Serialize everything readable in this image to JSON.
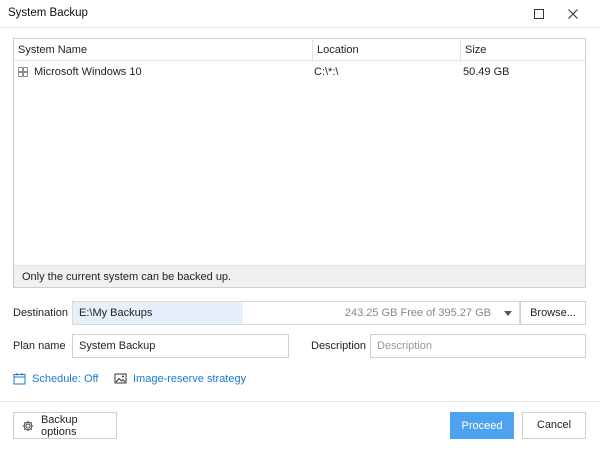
{
  "window": {
    "title": "System Backup"
  },
  "table": {
    "columns": [
      "System Name",
      "Location",
      "Size"
    ],
    "rows": [
      {
        "name": "Microsoft Windows 10",
        "location": "C:\\*:\\",
        "size": "50.49 GB"
      }
    ],
    "footer_note": "Only the current system can be backed up."
  },
  "destination": {
    "label": "Destination",
    "path": "E:\\My Backups",
    "free_space": "243.25 GB Free of 395.27 GB",
    "browse_label": "Browse..."
  },
  "plan": {
    "label": "Plan name",
    "value": "System Backup"
  },
  "description": {
    "label": "Description",
    "placeholder": "Description"
  },
  "links": {
    "schedule": "Schedule: Off",
    "strategy": "Image-reserve strategy"
  },
  "footer": {
    "options_label": "Backup options",
    "proceed_label": "Proceed",
    "cancel_label": "Cancel"
  },
  "colors": {
    "accent": "#4da3f0",
    "link": "#1a7ad4",
    "selection": "#e5f0fb"
  },
  "icons": {
    "row_icon": "windows-icon",
    "schedule": "calendar-icon",
    "strategy": "image-icon",
    "options": "gear-icon",
    "maximize": "maximize-icon",
    "close": "close-icon"
  }
}
